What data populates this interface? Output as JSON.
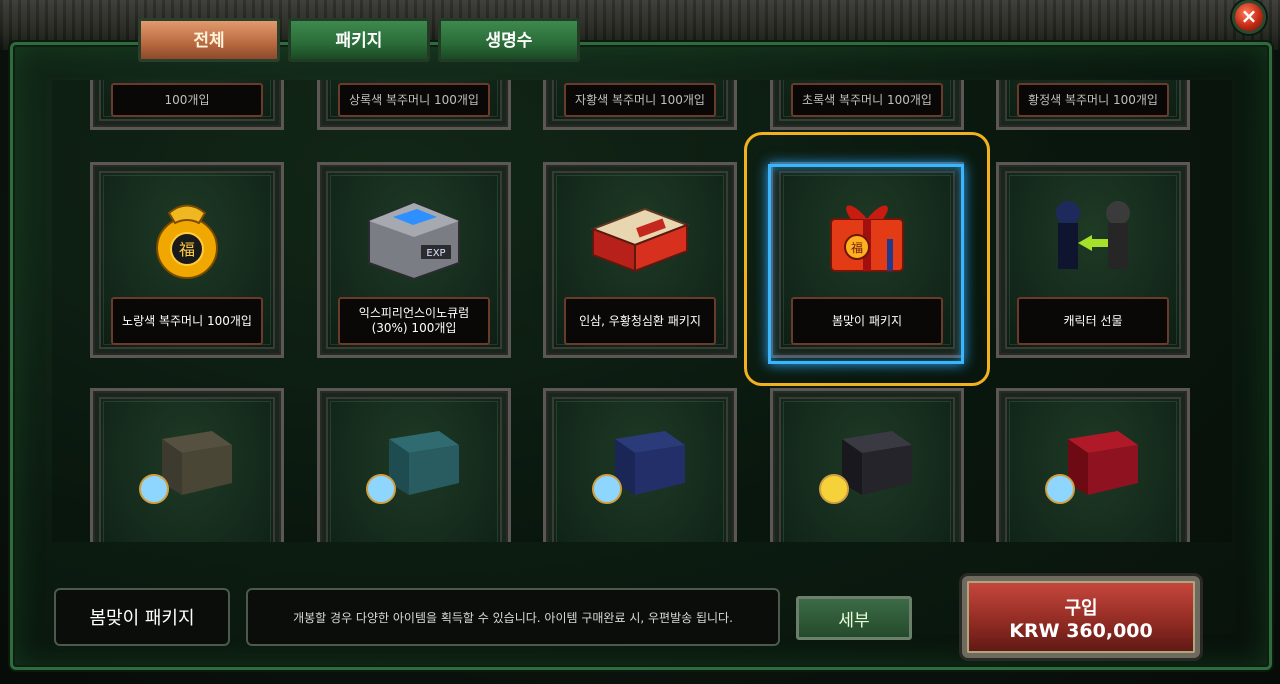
{
  "tabs": [
    {
      "label": "전체",
      "active": true
    },
    {
      "label": "패키지",
      "active": false
    },
    {
      "label": "생명수",
      "active": false
    }
  ],
  "top_row_partial_labels": [
    "100개입",
    "상록색 복주머니 100개입",
    "자황색 복주머니 100개입",
    "초록색 복주머니 100개입",
    "황정색 복주머니 100개입"
  ],
  "items": [
    {
      "label": "노랑색 복주머니 100개입",
      "icon": "gold-pouch-icon"
    },
    {
      "label": "익스피리언스이노큐럼\n(30%) 100개입",
      "icon": "exp-crate-icon"
    },
    {
      "label": "인삼, 우황청심환 패키지",
      "icon": "red-box-icon"
    },
    {
      "label": "봄맞이 패키지",
      "icon": "gift-box-icon",
      "selected": true
    },
    {
      "label": "캐릭터 선물",
      "icon": "character-gift-icon"
    }
  ],
  "bottom_row_items": [
    {
      "icon": "dark-chest-potion-icon"
    },
    {
      "icon": "teal-chest-potion-icon"
    },
    {
      "icon": "navy-chest-potion-icon"
    },
    {
      "icon": "black-chest-potion-icon"
    },
    {
      "icon": "red-chest-potion-icon"
    }
  ],
  "detail": {
    "name": "봄맞이 패키지",
    "description": "개봉할 경우 다양한 아이템을 획득할 수 있습니다. 아이템 구매완료 시, 우편발송 됩니다.",
    "detail_button": "세부",
    "buy_label": "구입",
    "price": "KRW 360,000"
  },
  "colors": {
    "accent_selected": "#f2b21e",
    "glow": "#38b7ff",
    "tab_active": "#b8683f",
    "tab_inactive": "#2a6b38"
  }
}
